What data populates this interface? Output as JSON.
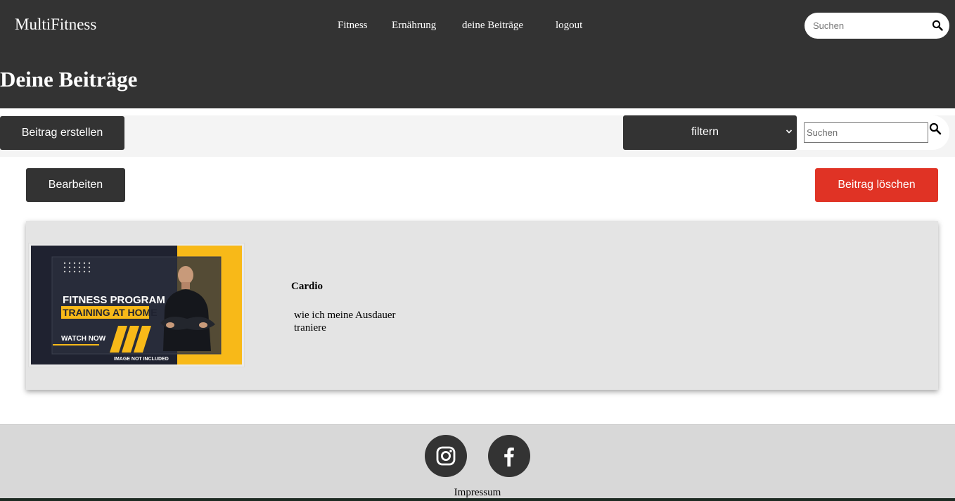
{
  "header": {
    "brand": "MultiFitness",
    "nav": [
      "Fitness",
      "Ernährung",
      "deine Beiträge",
      "logout"
    ],
    "search_placeholder": "Suchen",
    "page_title": "Deine Beiträge"
  },
  "toolbar": {
    "create_label": "Beitrag erstellen",
    "filter_label": "filtern",
    "search_placeholder": "Suchen"
  },
  "actions": {
    "edit_label": "Bearbeiten",
    "delete_label": "Beitrag löschen"
  },
  "post": {
    "title": "Cardio",
    "description": "wie ich meine Ausdauer traniere",
    "image": {
      "line1": "FITNESS PROGRAM",
      "line2": "TRAINING AT HOME",
      "cta": "WATCH NOW",
      "note": "IMAGE NOT INCLUDED"
    }
  },
  "footer": {
    "impressum": "Impressum"
  },
  "colors": {
    "header_bg": "#333333",
    "delete_red": "#e03325",
    "card_bg": "#e4e4e4",
    "banner_yellow": "#f8b918",
    "banner_dark": "#1f2230"
  }
}
